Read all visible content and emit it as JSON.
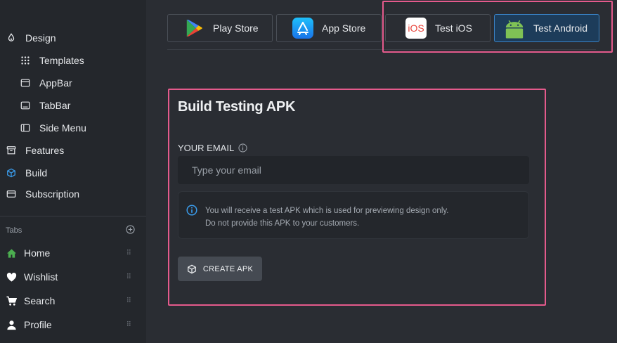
{
  "sidebar": {
    "design": "Design",
    "templates": "Templates",
    "appbar": "AppBar",
    "tabbar": "TabBar",
    "side_menu": "Side Menu",
    "features": "Features",
    "build": "Build",
    "subscription": "Subscription",
    "tabs_header": "Tabs",
    "tabs": [
      {
        "label": "Home",
        "icon": "home-icon"
      },
      {
        "label": "Wishlist",
        "icon": "heart-icon"
      },
      {
        "label": "Search",
        "icon": "cart-icon"
      },
      {
        "label": "Profile",
        "icon": "person-icon"
      }
    ]
  },
  "stores": {
    "play": "Play Store",
    "app": "App Store",
    "ios": "Test iOS",
    "ios_logo": "iOS",
    "android": "Test Android",
    "active": "Test Android"
  },
  "panel": {
    "title": "Build Testing APK",
    "email_label": "YOUR EMAIL",
    "email_placeholder": "Type your email",
    "notice_line1": "You will receive a test APK which is used for previewing design only.",
    "notice_line2": "Do not provide this APK to your customers.",
    "create_button": "CREATE APK"
  },
  "colors": {
    "background": "#2a2d33",
    "sidebar": "#24272c",
    "highlight": "#e45a8c",
    "active_button": "#1d3c5a",
    "accent_blue": "#3a9ae8",
    "home_green": "#4caf50"
  }
}
